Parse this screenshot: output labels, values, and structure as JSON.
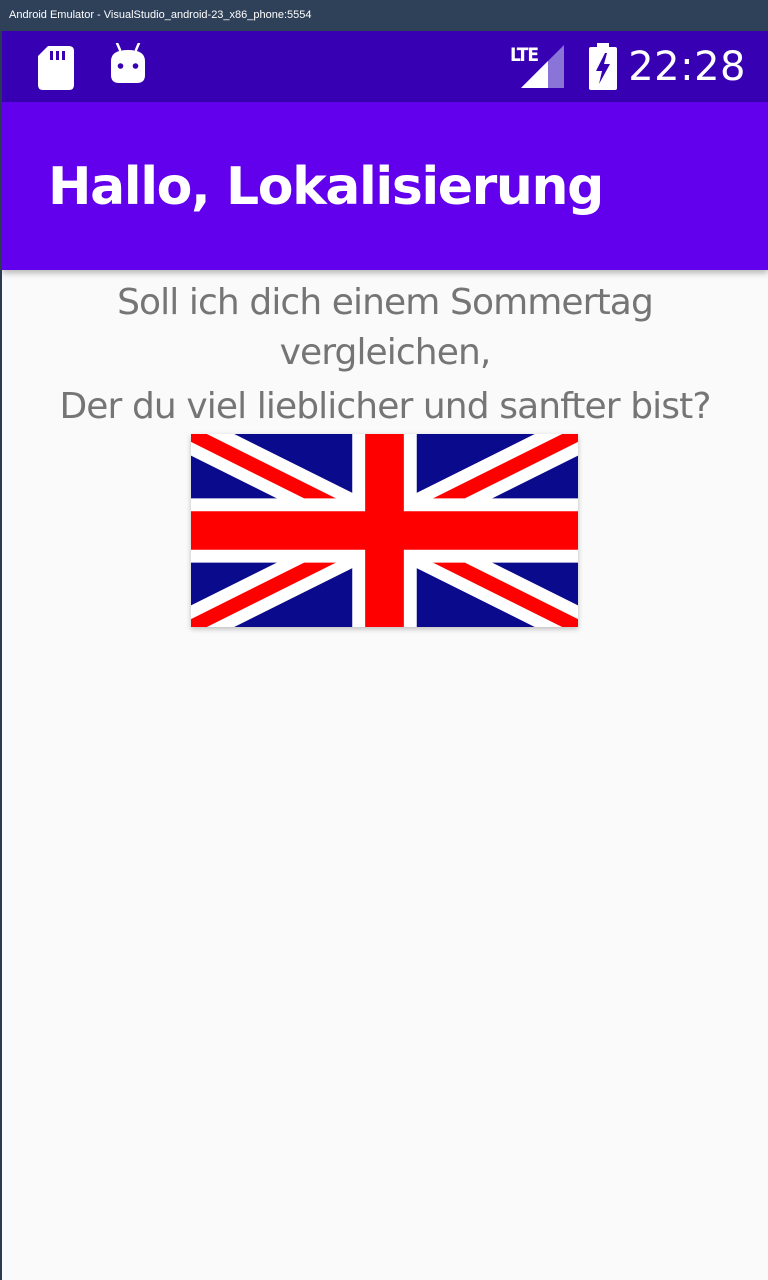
{
  "window": {
    "title": "Android Emulator - VisualStudio_android-23_x86_phone:5554"
  },
  "status_bar": {
    "time": "22:28",
    "network": "LTE",
    "icons": [
      "sd-card-icon",
      "android-debug-icon",
      "lte-signal-icon",
      "battery-charging-icon"
    ],
    "background": "#3700b3"
  },
  "app_bar": {
    "title": "Hallo, Lokalisierung",
    "background": "#6200ee"
  },
  "content": {
    "line1": "Soll ich dich einem Sommertag vergleichen,",
    "line2": "Der du viel lieblicher und sanfter bist?",
    "text_color": "#757575",
    "image": "uk-flag-image"
  },
  "colors": {
    "background": "#fafafa",
    "flag_blue": "#0a0a8c",
    "flag_red": "#ff0000",
    "flag_white": "#ffffff"
  }
}
